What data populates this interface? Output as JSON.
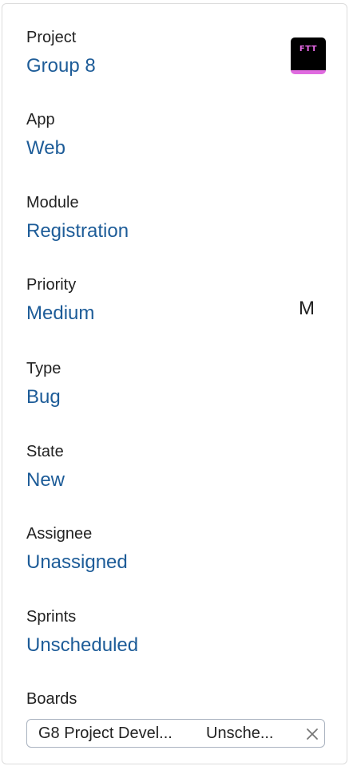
{
  "project": {
    "label": "Project",
    "value": "Group 8",
    "badge_text": "FTT"
  },
  "app": {
    "label": "App",
    "value": "Web"
  },
  "module": {
    "label": "Module",
    "value": "Registration"
  },
  "priority": {
    "label": "Priority",
    "value": "Medium",
    "code": "M"
  },
  "type": {
    "label": "Type",
    "value": "Bug"
  },
  "state": {
    "label": "State",
    "value": "New"
  },
  "assignee": {
    "label": "Assignee",
    "value": "Unassigned"
  },
  "sprints": {
    "label": "Sprints",
    "value": "Unscheduled"
  },
  "boards": {
    "label": "Boards",
    "chip_name": "G8 Project Devel...",
    "chip_status": "Unsche...",
    "remove_icon": "close-icon"
  },
  "colors": {
    "value_link": "#1d5c98",
    "badge_bg": "#000000",
    "badge_accent": "#e06be0"
  }
}
